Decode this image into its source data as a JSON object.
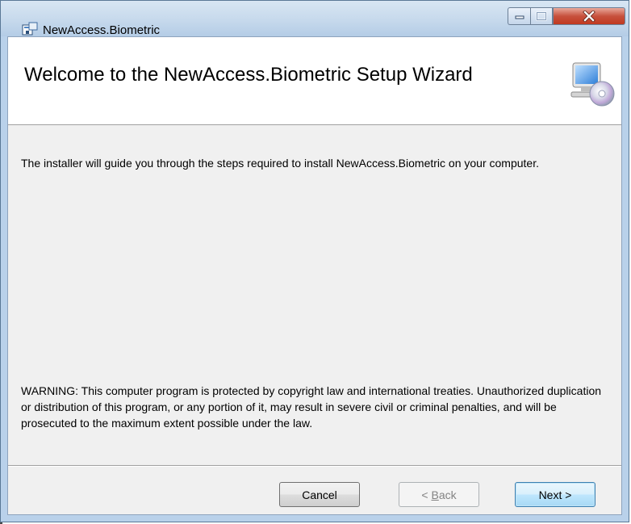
{
  "window": {
    "title": "NewAccess.Biometric"
  },
  "controls": {
    "minimize": "minimize",
    "maximize": "maximize",
    "close": "close"
  },
  "header": {
    "title": "Welcome to the NewAccess.Biometric Setup Wizard"
  },
  "body": {
    "intro": "The installer will guide you through the steps required to install NewAccess.Biometric on your computer.",
    "warning": "WARNING: This computer program is protected by copyright law and international treaties. Unauthorized duplication or distribution of this program, or any portion of it, may result in severe civil or criminal penalties, and will be prosecuted to the maximum extent possible under the law."
  },
  "buttons": {
    "cancel": "Cancel",
    "back_prefix": "< ",
    "back_accel": "B",
    "back_rest": "ack",
    "next": "Next >"
  },
  "icons": {
    "app": "installer-icon",
    "header": "computer-cd-icon"
  },
  "colors": {
    "close_button": "#c7513d",
    "header_bg": "#ffffff",
    "panel_bg": "#f0f0f0"
  }
}
